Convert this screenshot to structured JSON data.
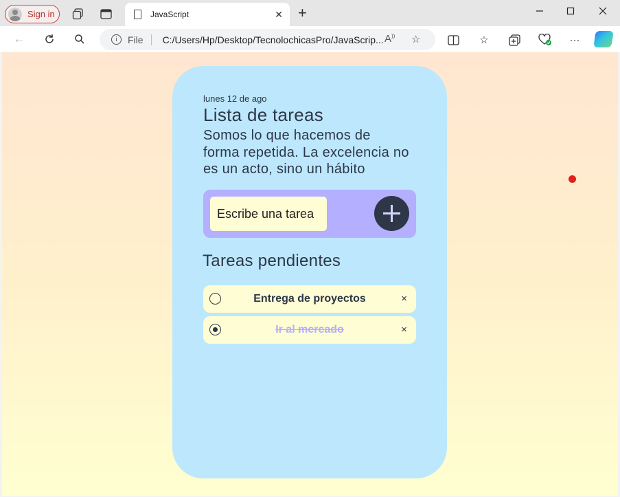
{
  "browser": {
    "signin_label": "Sign in",
    "tab_title": "JavaScript",
    "address_scheme": "File",
    "address_url": "C:/Users/Hp/Desktop/TecnolochicasPro/JavaScrip...",
    "icons": [
      "workspaces-icon",
      "vertical-tabs-icon",
      "document-icon",
      "back-icon",
      "refresh-icon",
      "search-icon",
      "info-icon",
      "read-aloud-icon",
      "favorite-star-icon",
      "split-screen-icon",
      "favorites-icon",
      "collections-icon",
      "browser-essentials-icon",
      "more-icon",
      "copilot-icon"
    ]
  },
  "app": {
    "date": "lunes 12 de ago",
    "title": "Lista de tareas",
    "quote": "Somos lo que hacemos de forma repetida. La excelencia no es un acto, sino un hábito",
    "input_placeholder": "Escribe una tarea",
    "section_title": "Tareas pendientes",
    "tasks": [
      {
        "text": "Entrega de proyectos",
        "done": false,
        "delete_symbol": "×"
      },
      {
        "text": "Ir al mercado",
        "done": true,
        "delete_symbol": "×"
      }
    ]
  },
  "colors": {
    "card": "#bde7fd",
    "form": "#b4afff",
    "input": "#fffdd3",
    "task": "#fffdd3",
    "text": "#2d3748",
    "add_button": "#2d3748",
    "done_text": "#b4afff",
    "background_top": "#ffe6d1",
    "background_bottom": "#ffffd1",
    "indicator": "#e0201c"
  }
}
